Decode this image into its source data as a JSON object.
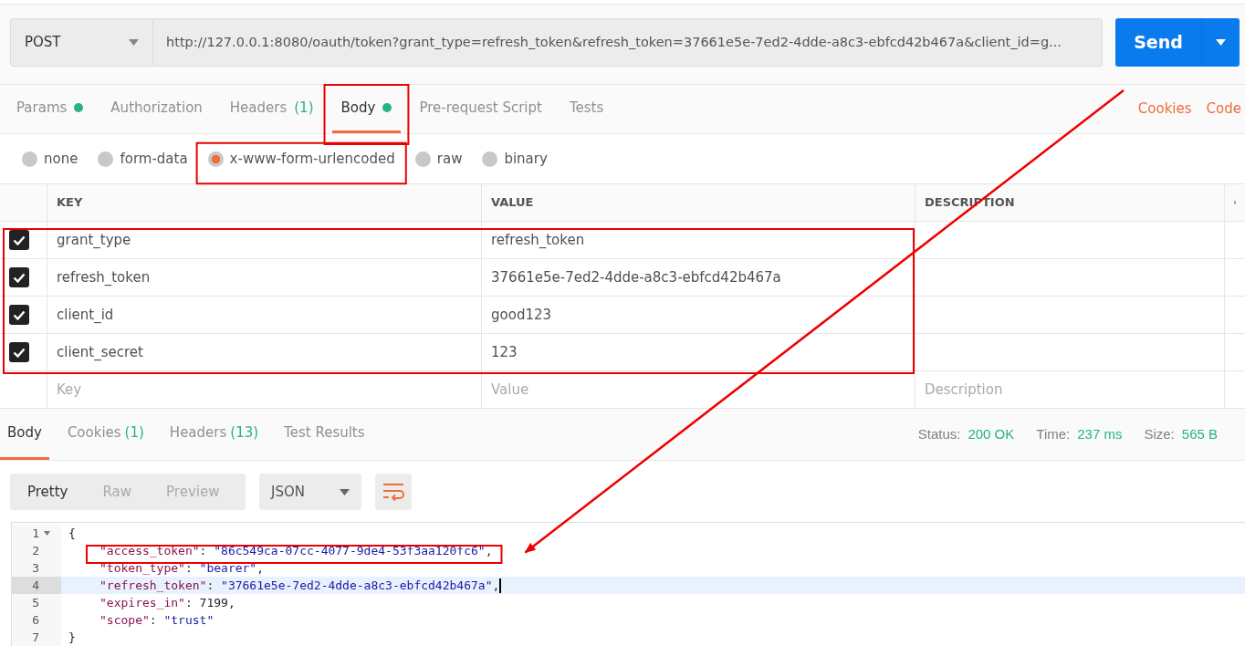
{
  "request": {
    "method": "POST",
    "url": "http://127.0.0.1:8080/oauth/token?grant_type=refresh_token&refresh_token=37661e5e-7ed2-4dde-a8c3-ebfcd42b467a&client_id=g...",
    "send_label": "Send"
  },
  "request_tabs": [
    {
      "label": "Params",
      "dot": true,
      "selected": false,
      "highlighted": false
    },
    {
      "label": "Authorization",
      "dot": false,
      "selected": false,
      "highlighted": false
    },
    {
      "label": "Headers",
      "count": "(1)",
      "dot": false,
      "selected": false,
      "highlighted": false
    },
    {
      "label": "Body",
      "dot": true,
      "selected": true,
      "highlighted": true
    },
    {
      "label": "Pre-request Script",
      "dot": false,
      "selected": false,
      "highlighted": false
    },
    {
      "label": "Tests",
      "dot": false,
      "selected": false,
      "highlighted": false
    }
  ],
  "request_links": [
    "Cookies",
    "Code"
  ],
  "body_types": [
    {
      "label": "none",
      "selected": false,
      "highlighted": false
    },
    {
      "label": "form-data",
      "selected": false,
      "highlighted": false
    },
    {
      "label": "x-www-form-urlencoded",
      "selected": true,
      "highlighted": true
    },
    {
      "label": "raw",
      "selected": false,
      "highlighted": false
    },
    {
      "label": "binary",
      "selected": false,
      "highlighted": false
    }
  ],
  "params_table": {
    "columns": [
      "KEY",
      "VALUE",
      "DESCRIPTION"
    ],
    "rows": [
      {
        "key": "grant_type",
        "value": "refresh_token",
        "checked": true,
        "highlighted": true
      },
      {
        "key": "refresh_token",
        "value": "37661e5e-7ed2-4dde-a8c3-ebfcd42b467a",
        "checked": true,
        "highlighted": true
      },
      {
        "key": "client_id",
        "value": "good123",
        "checked": true,
        "highlighted": true
      },
      {
        "key": "client_secret",
        "value": "123",
        "checked": true,
        "highlighted": true
      }
    ],
    "new_row": [
      {
        "placeholder": "Key"
      },
      {
        "placeholder": "Value"
      },
      {
        "placeholder": "Description"
      }
    ]
  },
  "response_tabs": [
    {
      "label": "Body",
      "selected": true
    },
    {
      "label": "Cookies",
      "count": "(1)",
      "selected": false
    },
    {
      "label": "Headers",
      "count": "(13)",
      "selected": false
    },
    {
      "label": "Test Results",
      "selected": false
    }
  ],
  "response_stats": [
    {
      "label": "Status:",
      "value": "200 OK"
    },
    {
      "label": "Time:",
      "value": "237 ms"
    },
    {
      "label": "Size:",
      "value": "565 B"
    }
  ],
  "view_modes": [
    {
      "label": "Pretty",
      "selected": true
    },
    {
      "label": "Raw",
      "selected": false
    },
    {
      "label": "Preview",
      "selected": false
    }
  ],
  "format": "JSON",
  "code_lines": [
    {
      "number": "1",
      "foldable": true,
      "current": false,
      "highlighted": false,
      "tokens": [
        {
          "kind": "punct",
          "text": "{"
        }
      ]
    },
    {
      "number": "2",
      "foldable": false,
      "current": false,
      "highlighted": true,
      "tokens": [
        {
          "kind": "key",
          "text": "\"access_token\""
        },
        {
          "kind": "punct",
          "text": ": "
        },
        {
          "kind": "string",
          "text": "\"86c549ca-07cc-4077-9de4-53f3aa120fc6\""
        },
        {
          "kind": "punct",
          "text": ","
        }
      ]
    },
    {
      "number": "3",
      "foldable": false,
      "current": false,
      "highlighted": false,
      "tokens": [
        {
          "kind": "key",
          "text": "\"token_type\""
        },
        {
          "kind": "punct",
          "text": ": "
        },
        {
          "kind": "string",
          "text": "\"bearer\""
        },
        {
          "kind": "punct",
          "text": ","
        }
      ]
    },
    {
      "number": "4",
      "foldable": false,
      "current": true,
      "highlighted": false,
      "tokens": [
        {
          "kind": "key",
          "text": "\"refresh_token\""
        },
        {
          "kind": "punct",
          "text": ": "
        },
        {
          "kind": "string",
          "text": "\"37661e5e-7ed2-4dde-a8c3-ebfcd42b467a\""
        },
        {
          "kind": "punct",
          "text": ","
        }
      ]
    },
    {
      "number": "5",
      "foldable": false,
      "current": false,
      "highlighted": false,
      "tokens": [
        {
          "kind": "key",
          "text": "\"expires_in\""
        },
        {
          "kind": "punct",
          "text": ": 7199,"
        }
      ]
    },
    {
      "number": "6",
      "foldable": false,
      "current": false,
      "highlighted": false,
      "tokens": [
        {
          "kind": "key",
          "text": "\"scope\""
        },
        {
          "kind": "punct",
          "text": ": "
        },
        {
          "kind": "string",
          "text": "\"trust\""
        }
      ]
    },
    {
      "number": "7",
      "foldable": false,
      "current": false,
      "highlighted": false,
      "tokens": [
        {
          "kind": "punct",
          "text": "}"
        }
      ]
    }
  ]
}
